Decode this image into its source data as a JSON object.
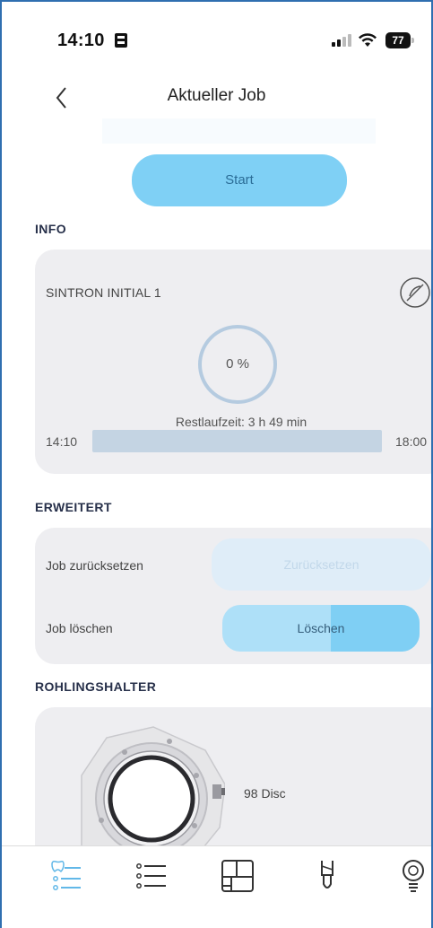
{
  "status_bar": {
    "time": "14:10",
    "battery": "77",
    "icons": [
      "sim-card-icon",
      "signal-icon",
      "wifi-icon",
      "battery-icon"
    ]
  },
  "header": {
    "title": "Aktueller Job",
    "back_icon": "chevron-left-icon"
  },
  "start_button": {
    "label": "Start"
  },
  "info": {
    "section_title": "INFO",
    "job_name": "SINTRON INITIAL 1",
    "status_icon": "prohibited-icon",
    "progress_text": "0 %",
    "progress_fraction": 0,
    "remaining": "Restlaufzeit: 3 h 49 min",
    "time_start": "14:10",
    "time_end": "18:00"
  },
  "advanced": {
    "section_title": "ERWEITERT",
    "reset_label": "Job zurücksetzen",
    "reset_button": "Zurücksetzen",
    "delete_label": "Job löschen",
    "delete_button": "Löschen"
  },
  "holder": {
    "section_title": "ROHLINGSHALTER",
    "label": "98 Disc",
    "image_icon": "disc-holder-image"
  },
  "bottom_nav": {
    "items": [
      {
        "icon": "tooth-list-icon",
        "active": true
      },
      {
        "icon": "list-icon",
        "active": false
      },
      {
        "icon": "layout-icon",
        "active": false
      },
      {
        "icon": "milling-tool-icon",
        "active": false
      },
      {
        "icon": "lightbulb-icon",
        "active": false
      }
    ]
  },
  "colors": {
    "accent": "#7fd0f5",
    "section_title": "#27304a",
    "card_bg": "#eeeef1",
    "active_nav": "#62b8e8"
  }
}
